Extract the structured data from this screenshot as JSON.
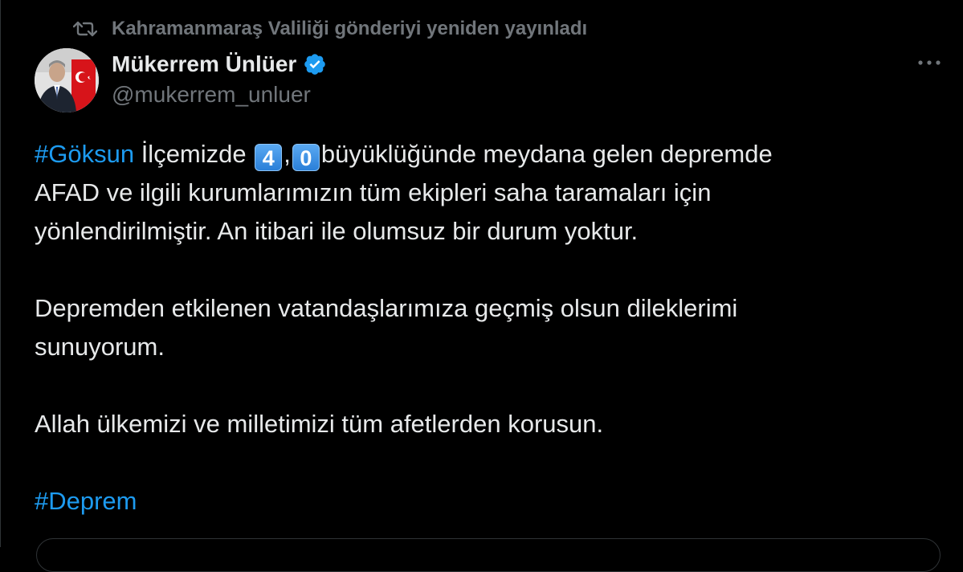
{
  "retweet": {
    "icon": "retweet-icon",
    "text": "Kahramanmaraş Valiliği gönderiyi yeniden yayınladı"
  },
  "author": {
    "display_name": "Mükerrem Ünlüer",
    "handle": "@mukerrem_unluer",
    "verified": true,
    "verified_color": "#1d9bf0"
  },
  "menu": {
    "icon": "more-icon"
  },
  "tweet": {
    "hashtag_1": "#Göksun",
    "line1_a": " İlçemizde ",
    "digit_1": "4",
    "comma": ",",
    "digit_2": "0",
    "line1_b": "büyüklüğünde meydana gelen depremde",
    "line2": "AFAD ve ilgili kurumlarımızın tüm ekipleri saha taramaları için",
    "line3": "yönlendirilmiştir. An itibari ile olumsuz bir durum yoktur.",
    "line4": "Depremden etkilenen vatandaşlarımıza geçmiş olsun dileklerimi",
    "line5": "sunuyorum.",
    "line6": "Allah ülkemizi ve milletimizi tüm afetlerden korusun.",
    "hashtag_2": "#Deprem"
  },
  "colors": {
    "background": "#000000",
    "text": "#e7e9ea",
    "secondary": "#71767b",
    "link": "#1d9bf0"
  }
}
